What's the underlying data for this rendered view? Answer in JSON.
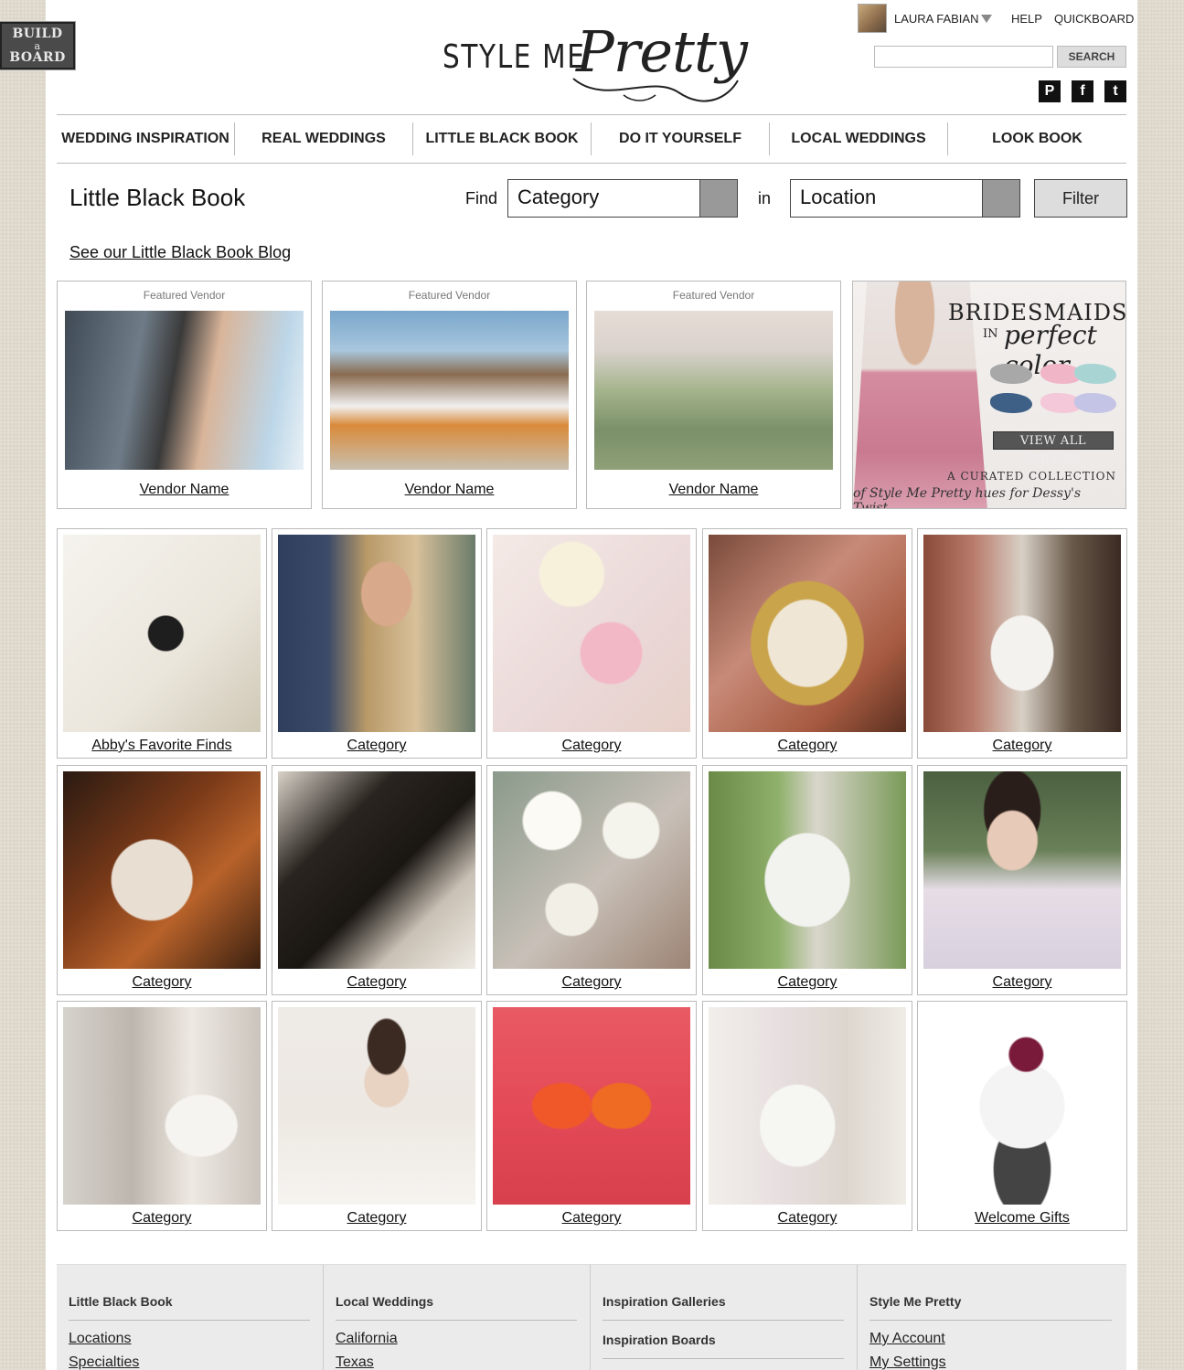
{
  "build_board": {
    "line1": "BUILD",
    "line2": "a",
    "line3": "BOARD"
  },
  "logo": {
    "style": "STYLE ME",
    "pretty": "Pretty"
  },
  "header": {
    "user_name": "LAURA FABIAN",
    "help": "HELP",
    "quickboard": "QUICKBOARD",
    "search_placeholder": "",
    "search_button": "SEARCH",
    "social": [
      {
        "icon": "pinterest-icon",
        "glyph": "P"
      },
      {
        "icon": "facebook-icon",
        "glyph": "f"
      },
      {
        "icon": "twitter-icon",
        "glyph": "t"
      }
    ]
  },
  "nav": [
    "WEDDING INSPIRATION",
    "REAL WEDDINGS",
    "LITTLE BLACK BOOK",
    "DO IT YOURSELF",
    "LOCAL WEDDINGS",
    "LOOK BOOK"
  ],
  "filter": {
    "title": "Little Black Book",
    "find_label": "Find",
    "category_value": "Category",
    "in_label": "in",
    "location_value": "Location",
    "filter_button": "Filter"
  },
  "blog_link": "See our Little Black Book Blog",
  "featured_vendors": [
    {
      "label": "Featured Vendor",
      "name": "Vendor Name"
    },
    {
      "label": "Featured Vendor",
      "name": "Vendor Name"
    },
    {
      "label": "Featured Vendor",
      "name": "Vendor Name"
    }
  ],
  "ad": {
    "headline": "BRIDESMAIDS",
    "in": "IN",
    "perfect_color": "perfect color",
    "button": "VIEW ALL COLORS",
    "caption1": "A CURATED COLLECTION",
    "caption2": "of Style Me Pretty hues for Dessy's Twist",
    "swatch_colors": [
      "#a8a8a8",
      "#f0b6c8",
      "#a9d4d4",
      "#3e5f86",
      "#f4c8d8",
      "#c4c4e6"
    ]
  },
  "categories": [
    {
      "name": "Abby's Favorite Finds"
    },
    {
      "name": "Category"
    },
    {
      "name": "Category"
    },
    {
      "name": "Category"
    },
    {
      "name": "Category"
    },
    {
      "name": "Category"
    },
    {
      "name": "Category"
    },
    {
      "name": "Category"
    },
    {
      "name": "Category"
    },
    {
      "name": "Category"
    },
    {
      "name": "Category"
    },
    {
      "name": "Category"
    },
    {
      "name": "Category"
    },
    {
      "name": "Category"
    },
    {
      "name": "Welcome Gifts"
    }
  ],
  "footer": {
    "columns": [
      {
        "heading": "Little Black Book",
        "links": [
          "Locations",
          "Specialties"
        ]
      },
      {
        "heading": "Local Weddings",
        "links": [
          "California",
          "Texas"
        ]
      },
      {
        "heading": "Inspiration Galleries",
        "heading2": "Inspiration Boards"
      },
      {
        "heading": "Style Me Pretty",
        "links": [
          "My Account",
          "My Settings"
        ]
      }
    ]
  },
  "colors": {
    "page_bg": "#e2dccf",
    "accent": "#222222"
  }
}
